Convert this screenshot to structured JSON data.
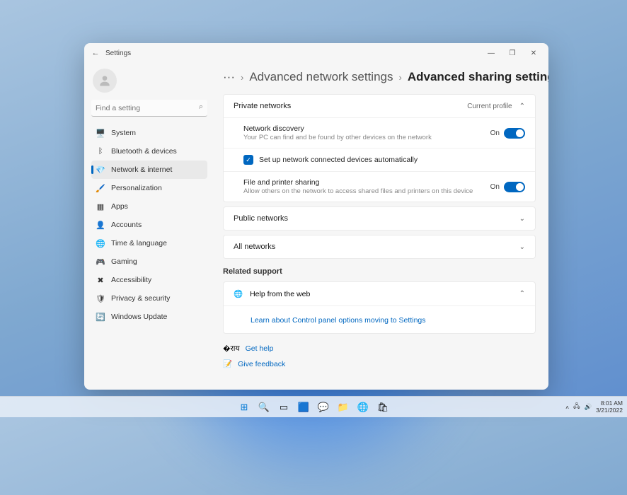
{
  "window": {
    "title": "Settings"
  },
  "search": {
    "placeholder": "Find a setting"
  },
  "sidebar": {
    "items": [
      {
        "label": "System",
        "icon": "🖥️"
      },
      {
        "label": "Bluetooth & devices",
        "icon": "ᛒ"
      },
      {
        "label": "Network & internet",
        "icon": "💎",
        "active": true
      },
      {
        "label": "Personalization",
        "icon": "🖌️"
      },
      {
        "label": "Apps",
        "icon": "▦"
      },
      {
        "label": "Accounts",
        "icon": "👤"
      },
      {
        "label": "Time & language",
        "icon": "🌐"
      },
      {
        "label": "Gaming",
        "icon": "🎮"
      },
      {
        "label": "Accessibility",
        "icon": "✖"
      },
      {
        "label": "Privacy & security",
        "icon": "🛡"
      },
      {
        "label": "Windows Update",
        "icon": "🔄"
      }
    ]
  },
  "breadcrumb": {
    "more": "···",
    "parent": "Advanced network settings",
    "current": "Advanced sharing settings"
  },
  "private": {
    "title": "Private networks",
    "badge": "Current profile",
    "discovery": {
      "title": "Network discovery",
      "sub": "Your PC can find and be found by other devices on the network",
      "state": "On"
    },
    "autosetup": {
      "label": "Set up network connected devices automatically"
    },
    "sharing": {
      "title": "File and printer sharing",
      "sub": "Allow others on the network to access shared files and printers on this device",
      "state": "On"
    }
  },
  "public": {
    "title": "Public networks"
  },
  "all": {
    "title": "All networks"
  },
  "support": {
    "heading": "Related support",
    "help_web": "Help from the web",
    "link1": "Learn about Control panel options moving to Settings",
    "get_help": "Get help",
    "feedback": "Give feedback"
  },
  "tray": {
    "time": "8:01 AM",
    "date": "3/21/2022"
  }
}
